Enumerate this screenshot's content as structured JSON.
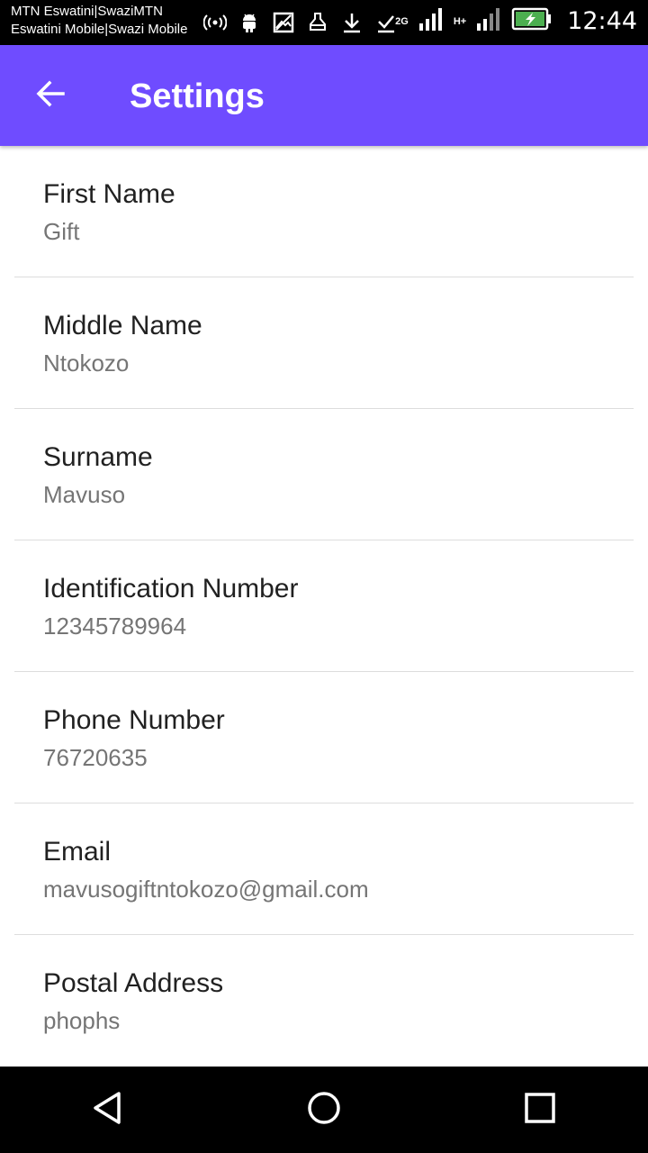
{
  "status_bar": {
    "carrier_line1": "MTN Eswatini|SwaziMTN",
    "carrier_line2": "Eswatini Mobile|Swazi Mobile",
    "net1": "2G",
    "net2": "H+",
    "time": "12:44",
    "icons": [
      "hotspot-icon",
      "android-icon",
      "image-icon",
      "cleaner-icon",
      "download-icon",
      "check-icon",
      "signal-icon",
      "signal-icon",
      "battery-icon"
    ]
  },
  "app_bar": {
    "title": "Settings",
    "back_icon": "arrow-left-icon",
    "color": "#6f4cff"
  },
  "settings": [
    {
      "label": "First Name",
      "value": "Gift"
    },
    {
      "label": "Middle Name",
      "value": "Ntokozo"
    },
    {
      "label": "Surname",
      "value": "Mavuso"
    },
    {
      "label": "Identification Number",
      "value": "12345789964"
    },
    {
      "label": "Phone Number",
      "value": "76720635"
    },
    {
      "label": "Email",
      "value": "mavusogiftntokozo@gmail.com"
    },
    {
      "label": "Postal Address",
      "value": "phophs"
    }
  ],
  "nav_bar": {
    "icons": [
      "back-triangle-icon",
      "home-circle-icon",
      "recents-square-icon"
    ]
  }
}
